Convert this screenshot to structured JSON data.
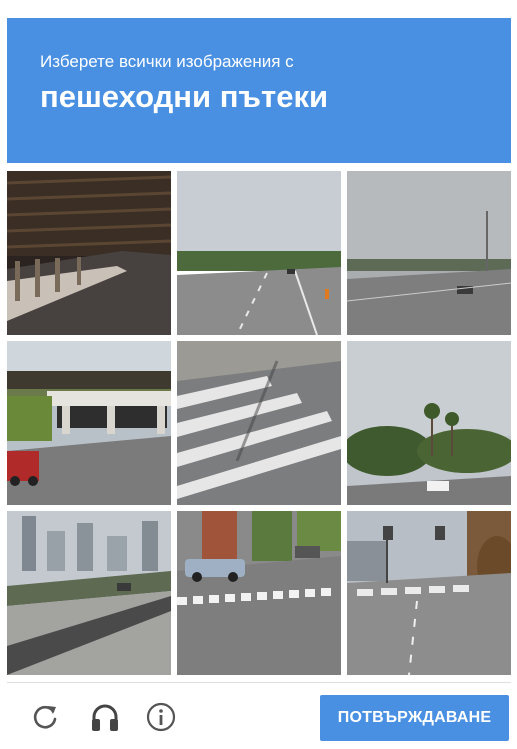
{
  "captcha": {
    "instruction": "Изберете всички изображения с",
    "target": "пешеходни пътеки"
  },
  "tiles": [
    {
      "name": "tile-1",
      "description": "under-bridge-underpass"
    },
    {
      "name": "tile-2",
      "description": "highway"
    },
    {
      "name": "tile-3",
      "description": "highway-cloudy"
    },
    {
      "name": "tile-4",
      "description": "overpass-with-train"
    },
    {
      "name": "tile-5",
      "description": "crosswalk-closeup"
    },
    {
      "name": "tile-6",
      "description": "road-with-palm-trees"
    },
    {
      "name": "tile-7",
      "description": "city-skyline-road"
    },
    {
      "name": "tile-8",
      "description": "intersection-with-crosswalk"
    },
    {
      "name": "tile-9",
      "description": "street-with-crosswalk"
    }
  ],
  "footer": {
    "icons": [
      "reload-icon",
      "headphones-icon",
      "info-icon"
    ],
    "verify_label": "ПОТВЪРЖДАВАНЕ"
  },
  "colors": {
    "accent": "#4a90e2",
    "icon": "#555555",
    "divider": "#dfdfdf"
  }
}
